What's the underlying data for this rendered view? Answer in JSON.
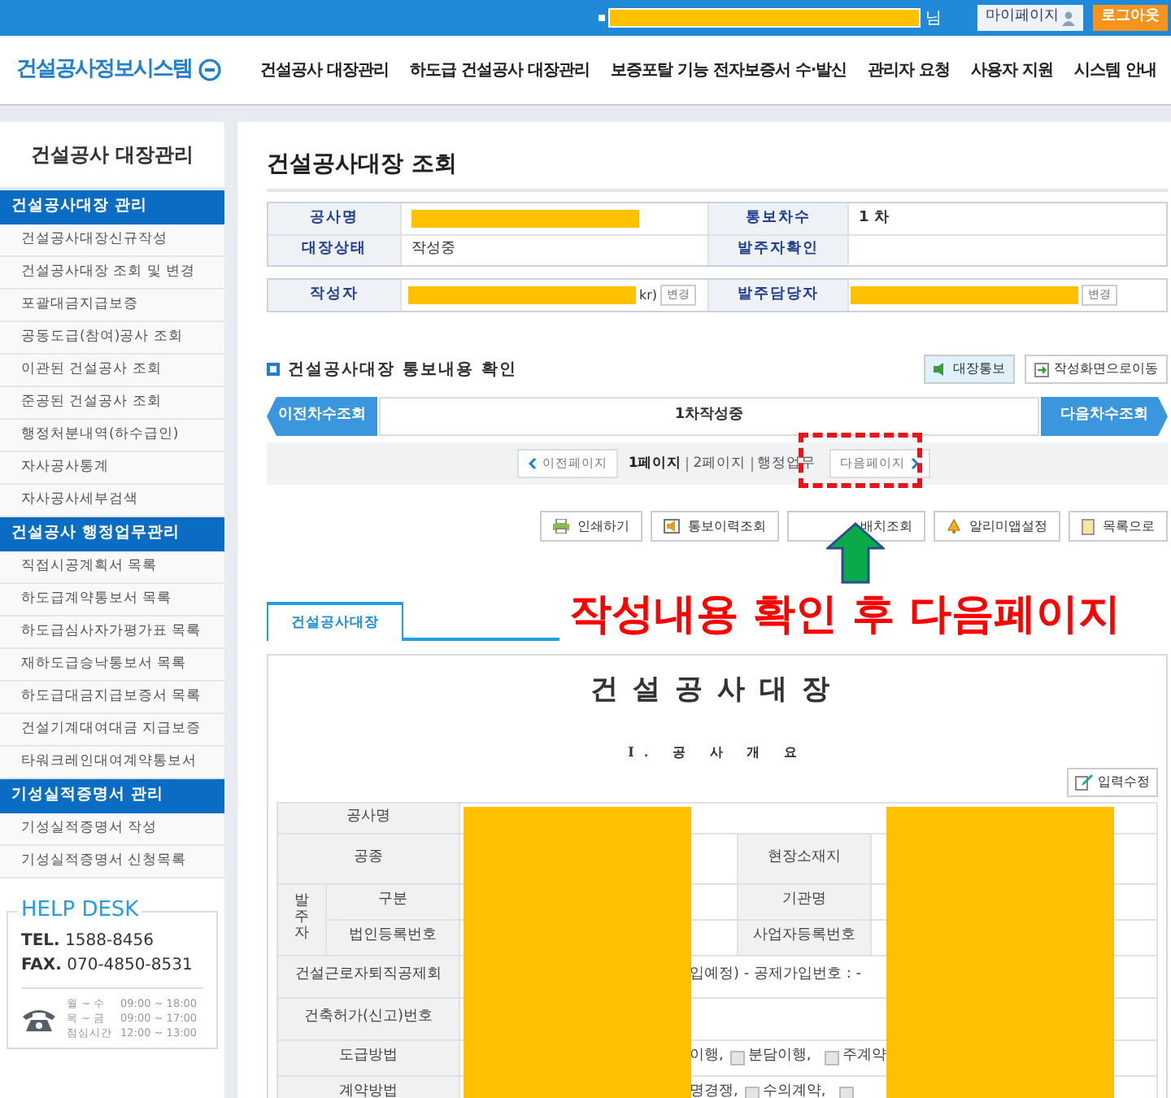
{
  "top_bar": {
    "suffix": "님",
    "mypage": "마이페이지",
    "logout": "로그아웃"
  },
  "logo": "건설공사정보시스템",
  "nav": [
    "건설공사 대장관리",
    "하도급 건설공사 대장관리",
    "보증포탈 기능 전자보증서 수·발신",
    "관리자 요청",
    "사용자 지원",
    "시스템 안내"
  ],
  "sidebar": {
    "title": "건설공사 대장관리",
    "sections": [
      {
        "title": "건설공사대장 관리",
        "items": [
          "건설공사대장신규작성",
          "건설공사대장 조회 및 변경",
          "포괄대금지급보증",
          "공동도급(참여)공사 조회",
          "이관된 건설공사 조회",
          "준공된 건설공사 조회",
          "행정처분내역(하수급인)",
          "자사공사통계",
          "자사공사세부검색"
        ]
      },
      {
        "title": "건설공사 행정업무관리",
        "items": [
          "직접시공계획서 목록",
          "하도급계약통보서 목록",
          "하도급심사자가평가표 목록",
          "재하도급승낙통보서 목록",
          "하도급대금지급보증서 목록",
          "건설기계대여대금 지급보증",
          "타워크레인대여계약통보서"
        ]
      },
      {
        "title": "기성실적증명서 관리",
        "items": [
          "기성실적증명서 작성",
          "기성실적증명서 신청목록"
        ]
      }
    ]
  },
  "help_desk": {
    "title": "HELP DESK",
    "tel": "**TEL.** 1588-8456",
    "fax": "**FAX.** 070-4850-8531",
    "hours": [
      {
        "days": "월 ~ 수",
        "time": "09:00 ~ 18:00"
      },
      {
        "days": "목 ~ 금",
        "time": "09:00 ~ 17:00"
      },
      {
        "days": "점심시간",
        "time": "12:00 ~ 13:00"
      }
    ]
  },
  "page_title": "건설공사대장 조회",
  "info_table": [
    {
      "label": "공사명",
      "label2": "통보차수",
      "value2": "1 차"
    },
    {
      "label": "대장상태",
      "value": "작성중",
      "label2": "발주자확인"
    }
  ],
  "info_table2": {
    "label": "작성자",
    "suffix": "kr)",
    "change": "변경",
    "label2": "발주담당자",
    "change2": "변경"
  },
  "section": {
    "title": "건설공사대장 통보내용 확인",
    "buttons": [
      "대장통보",
      "작성화면으로이동"
    ]
  },
  "revision_bar": {
    "prev": "이전차수조회",
    "current": "1차작성중",
    "next": "다음차수조회"
  },
  "paging": {
    "prev": "이전페이지",
    "pages": [
      {
        "label": "1페이지",
        "selected": true
      },
      {
        "label": "2페이지",
        "selected": false
      },
      {
        "label": "행정업무",
        "selected": false
      }
    ],
    "next": "다음페이지"
  },
  "actions": [
    {
      "kind": "print",
      "label": "인쇄하기"
    },
    {
      "kind": "history",
      "label": "통보이력조회"
    },
    {
      "kind": "placement",
      "label": "배치조회"
    },
    {
      "kind": "alarm",
      "label": "알리미앱설정"
    },
    {
      "kind": "list",
      "label": "목록으로"
    }
  ],
  "tabs": [
    {
      "label": "건설공사대장",
      "selected": true
    }
  ],
  "annotation": "작성내용 확인 후 다음페이지",
  "document": {
    "title": "건설공사대장",
    "section": "I. 공 사 개 요",
    "edit_button": "입력수정",
    "rows": [
      {
        "kind": "full",
        "label": "공사명"
      },
      {
        "kind": "pair",
        "label": "공종",
        "label2": "현장소재지"
      },
      {
        "kind": "group",
        "group": "발주자",
        "rows": [
          {
            "label": "구분",
            "label2": "기관명"
          },
          {
            "label": "법인등록번호",
            "label2": "사업자등록번호"
          }
        ]
      },
      {
        "kind": "full",
        "label": "건설근로자퇴직공제회",
        "parts": [
          {
            "kind": "text",
            "text": "입예정)   - 공제가입번호 : -"
          }
        ]
      },
      {
        "kind": "full",
        "label": "건축허가(신고)번호"
      },
      {
        "kind": "full",
        "label": "도급방법",
        "parts": [
          {
            "kind": "text",
            "text": "이행,"
          },
          {
            "kind": "checkbox",
            "text": "분담이행,",
            "checked": false
          },
          {
            "kind": "checkbox",
            "text": "주계약",
            "checked": false
          }
        ]
      },
      {
        "kind": "full",
        "label": "계약방법",
        "parts": [
          {
            "kind": "text",
            "text": "명경쟁,"
          },
          {
            "kind": "checkbox",
            "text": "수의계약,",
            "checked": false
          },
          {
            "kind": "checkbox",
            "checked": false
          }
        ]
      }
    ]
  }
}
